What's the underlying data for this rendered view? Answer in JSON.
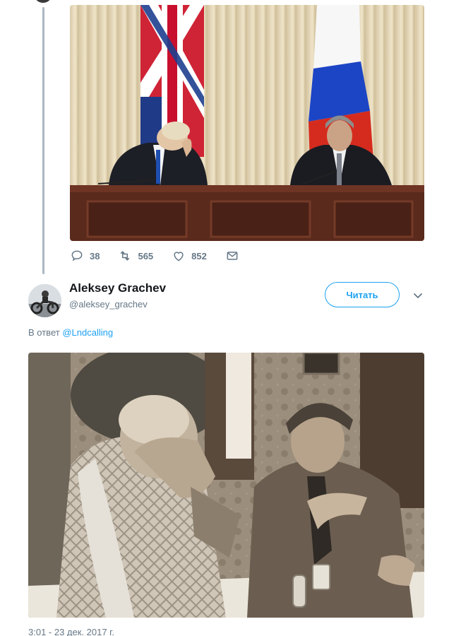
{
  "colors": {
    "accent": "#1da1f2",
    "muted": "#657786",
    "text": "#14171a",
    "thread_line": "#aab8c2"
  },
  "parent_tweet": {
    "actions": [
      {
        "icon": "reply-icon",
        "count": "38"
      },
      {
        "icon": "retweet-icon",
        "count": "565"
      },
      {
        "icon": "heart-icon",
        "count": "852"
      },
      {
        "icon": "message-icon",
        "count": ""
      }
    ]
  },
  "reply_tweet": {
    "author_name": "Aleksey Grachev",
    "author_handle": "@aleksey_grachev",
    "follow_label": "Читать",
    "reply_prefix": "В ответ",
    "reply_to": "@Lndcalling",
    "timestamp": "3:01 - 23 дек. 2017 г."
  }
}
